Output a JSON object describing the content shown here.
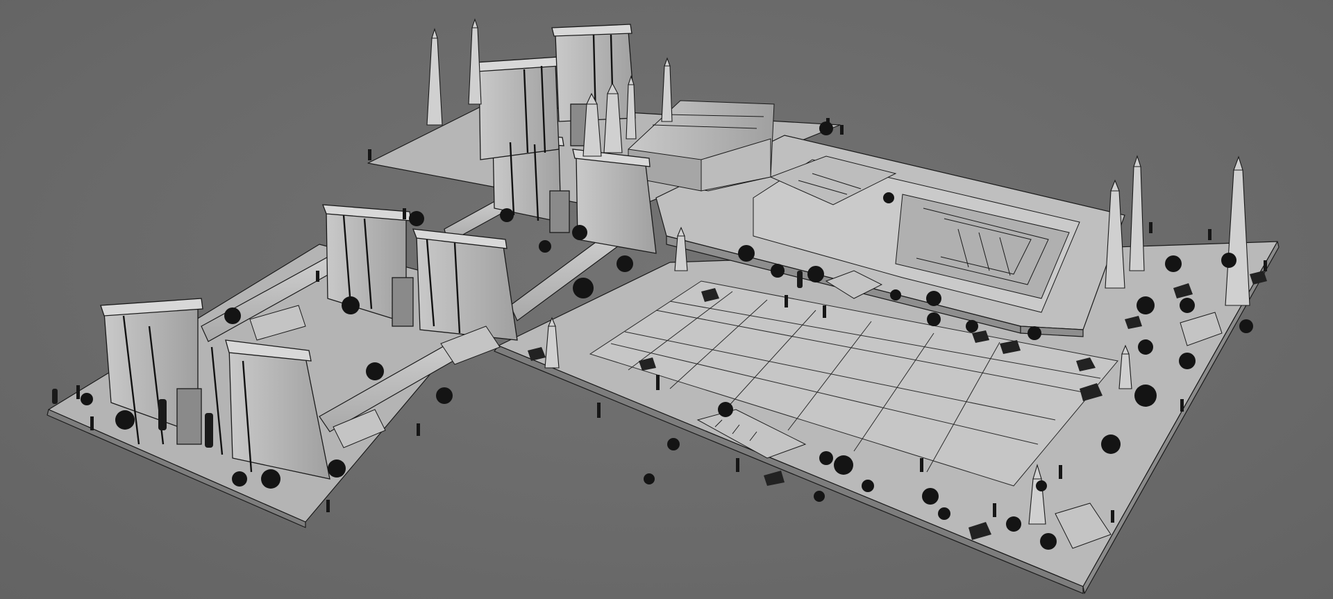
{
  "viewport": {
    "background_color": "#6b6b6b",
    "model_fill": "#bdbdbd",
    "model_shade": "#9a9a9a",
    "wire_color": "#1a1a1a",
    "foliage_color": "#151515"
  }
}
